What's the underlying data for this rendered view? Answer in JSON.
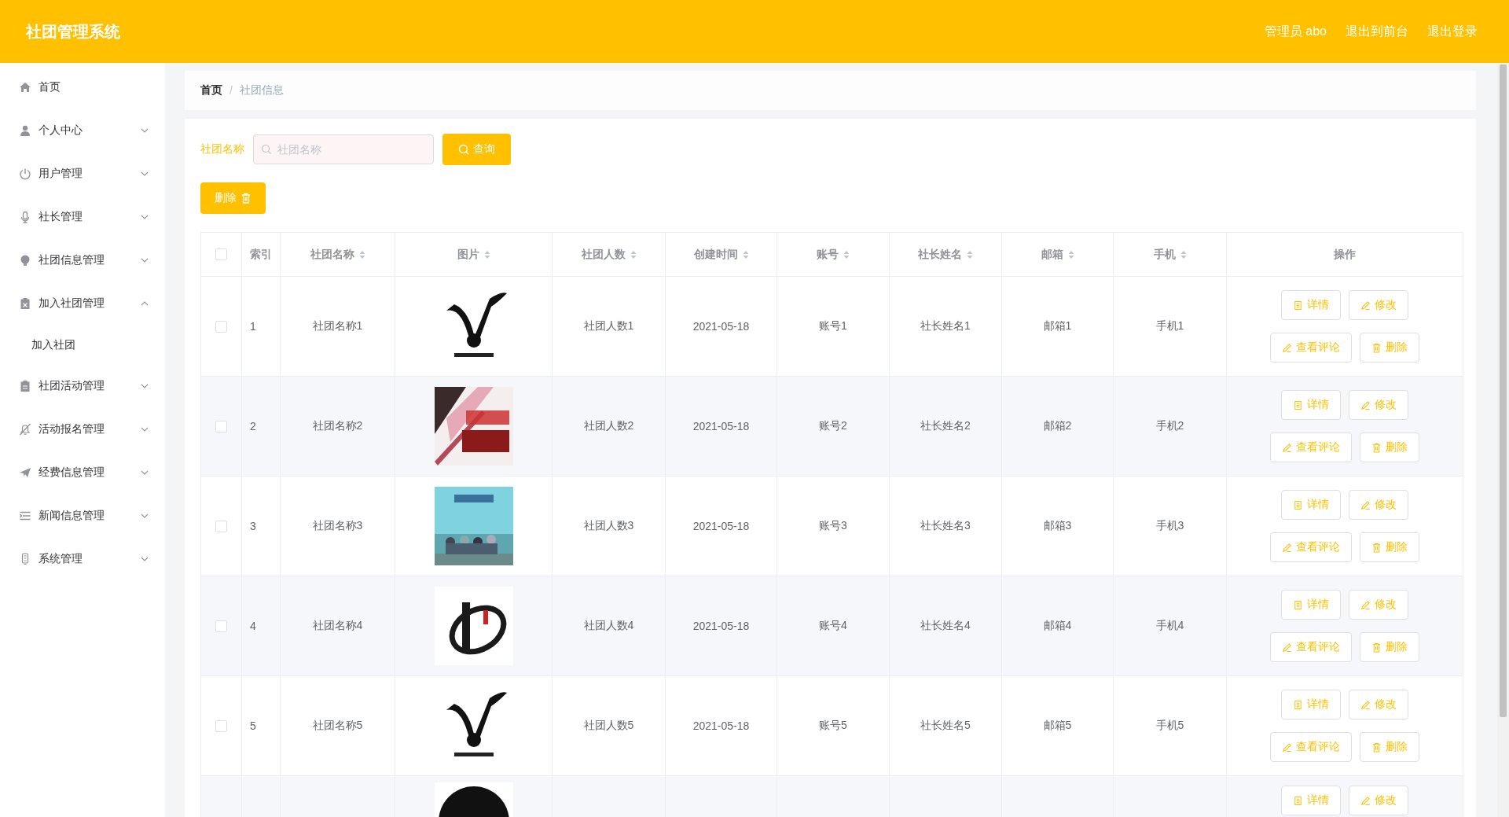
{
  "header": {
    "title": "社团管理系统",
    "links": [
      "管理员 abo",
      "退出到前台",
      "退出登录"
    ]
  },
  "sidebar": {
    "items": [
      {
        "label": "首页"
      },
      {
        "label": "个人中心",
        "expanded": false
      },
      {
        "label": "用户管理",
        "expanded": false
      },
      {
        "label": "社长管理",
        "expanded": false
      },
      {
        "label": "社团信息管理",
        "expanded": false
      },
      {
        "label": "加入社团管理",
        "expanded": true,
        "children": [
          {
            "label": "加入社团"
          }
        ]
      },
      {
        "label": "社团活动管理",
        "expanded": false
      },
      {
        "label": "活动报名管理",
        "expanded": false
      },
      {
        "label": "经费信息管理",
        "expanded": false
      },
      {
        "label": "新闻信息管理",
        "expanded": false
      },
      {
        "label": "系统管理",
        "expanded": false
      }
    ]
  },
  "breadcrumb": {
    "separator": "/",
    "items": [
      {
        "label": "首页"
      },
      {
        "label": "社团信息"
      }
    ]
  },
  "search": {
    "label": "社团名称",
    "placeholder": "社团名称",
    "button": "查询"
  },
  "delete_button": "删除",
  "table": {
    "select_all_checked": false,
    "columns": [
      {
        "label": "索引",
        "sortable": false
      },
      {
        "label": "社团名称",
        "sortable": true
      },
      {
        "label": "图片",
        "sortable": true
      },
      {
        "label": "社团人数",
        "sortable": true
      },
      {
        "label": "创建时间",
        "sortable": true
      },
      {
        "label": "账号",
        "sortable": true
      },
      {
        "label": "社长姓名",
        "sortable": true
      },
      {
        "label": "邮箱",
        "sortable": true
      },
      {
        "label": "手机",
        "sortable": true
      },
      {
        "label": "操作",
        "sortable": false
      }
    ],
    "rows": [
      {
        "checked": false,
        "cells": [
          "1",
          "社团名称1",
          null,
          "社团人数1",
          "2021-05-18",
          "账号1",
          "社长姓名1",
          "邮箱1",
          "手机1"
        ],
        "actions": [
          "详情",
          "修改",
          "查看评论",
          "删除"
        ]
      },
      {
        "checked": false,
        "cells": [
          "2",
          "社团名称2",
          null,
          "社团人数2",
          "2021-05-18",
          "账号2",
          "社长姓名2",
          "邮箱2",
          "手机2"
        ],
        "actions": [
          "详情",
          "修改",
          "查看评论",
          "删除"
        ]
      },
      {
        "checked": false,
        "cells": [
          "3",
          "社团名称3",
          null,
          "社团人数3",
          "2021-05-18",
          "账号3",
          "社长姓名3",
          "邮箱3",
          "手机3"
        ],
        "actions": [
          "详情",
          "修改",
          "查看评论",
          "删除"
        ]
      },
      {
        "checked": false,
        "cells": [
          "4",
          "社团名称4",
          null,
          "社团人数4",
          "2021-05-18",
          "账号4",
          "社长姓名4",
          "邮箱4",
          "手机4"
        ],
        "actions": [
          "详情",
          "修改",
          "查看评论",
          "删除"
        ]
      },
      {
        "checked": false,
        "cells": [
          "5",
          "社团名称5",
          null,
          "社团人数5",
          "2021-05-18",
          "账号5",
          "社长姓名5",
          "邮箱5",
          "手机5"
        ],
        "actions": [
          "详情",
          "修改",
          "查看评论",
          "删除"
        ]
      },
      {
        "actions": [
          "详情",
          "修改"
        ]
      }
    ]
  }
}
